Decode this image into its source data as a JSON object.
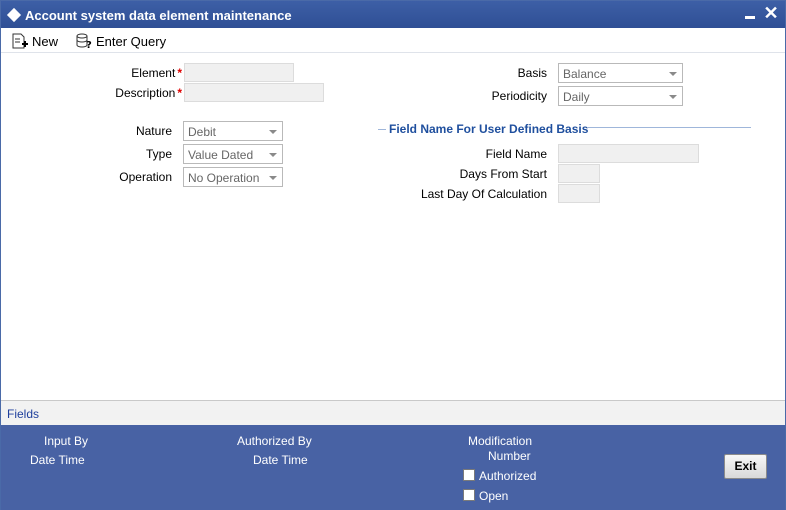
{
  "window": {
    "title": "Account system data element maintenance"
  },
  "toolbar": {
    "new_label": "New",
    "enter_query_label": "Enter Query"
  },
  "form": {
    "element_label": "Element",
    "description_label": "Description",
    "required_marker": "*",
    "nature_label": "Nature",
    "nature_value": "Debit",
    "type_label": "Type",
    "type_value": "Value Dated",
    "operation_label": "Operation",
    "operation_value": "No Operation",
    "basis_label": "Basis",
    "basis_value": "Balance",
    "periodicity_label": "Periodicity",
    "periodicity_value": "Daily"
  },
  "user_basis": {
    "section_title": "Field Name For User Defined Basis",
    "field_name_label": "Field Name",
    "days_from_start_label": "Days From Start",
    "last_day_label": "Last Day Of Calculation"
  },
  "fields_bar": {
    "link_label": "Fields"
  },
  "footer": {
    "input_by": "Input By",
    "date_time_1": "Date Time",
    "authorized_by": "Authorized By",
    "date_time_2": "Date Time",
    "modification": "Modification",
    "number": "Number",
    "authorized_label": "Authorized",
    "open_label": "Open",
    "exit_label": "Exit"
  }
}
